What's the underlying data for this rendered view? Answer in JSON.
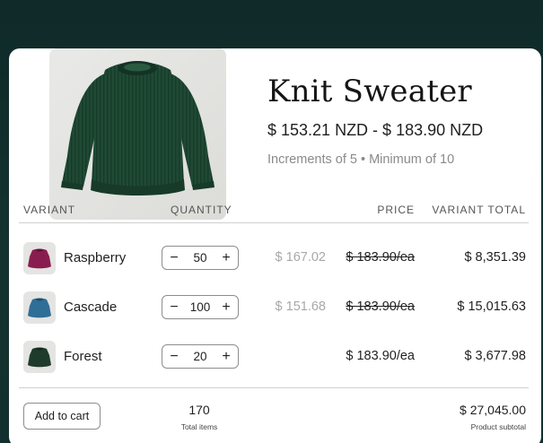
{
  "product": {
    "title": "Knit Sweater",
    "price_range": "$ 153.21 NZD - $ 183.90 NZD",
    "increments_note": "Increments of 5 • Minimum of 10",
    "image_icon": "sweater-image",
    "image_color": "#1f4a34"
  },
  "table": {
    "headers": {
      "variant": "VARIANT",
      "quantity": "QUANTITY",
      "price": "PRICE",
      "variant_total": "VARIANT TOTAL"
    },
    "rows": [
      {
        "name": "Raspberry",
        "swatch_color": "#8a1d4f",
        "quantity": "50",
        "discounted_price": "$ 167.02",
        "unit_price": "$ 183.90/ea",
        "unit_price_struck": true,
        "total": "$ 8,351.39"
      },
      {
        "name": "Cascade",
        "swatch_color": "#2f6e96",
        "quantity": "100",
        "discounted_price": "$ 151.68",
        "unit_price": "$ 183.90/ea",
        "unit_price_struck": true,
        "total": "$ 15,015.63"
      },
      {
        "name": "Forest",
        "swatch_color": "#1f3b2c",
        "quantity": "20",
        "discounted_price": "",
        "unit_price": "$ 183.90/ea",
        "unit_price_struck": false,
        "total": "$ 3,677.98"
      }
    ],
    "stepper_minus": "−",
    "stepper_plus": "+"
  },
  "footer": {
    "add_to_cart_label": "Add to cart",
    "total_items": "170",
    "total_items_label": "Total items",
    "subtotal": "$ 27,045.00",
    "subtotal_label": "Product subtotal"
  }
}
